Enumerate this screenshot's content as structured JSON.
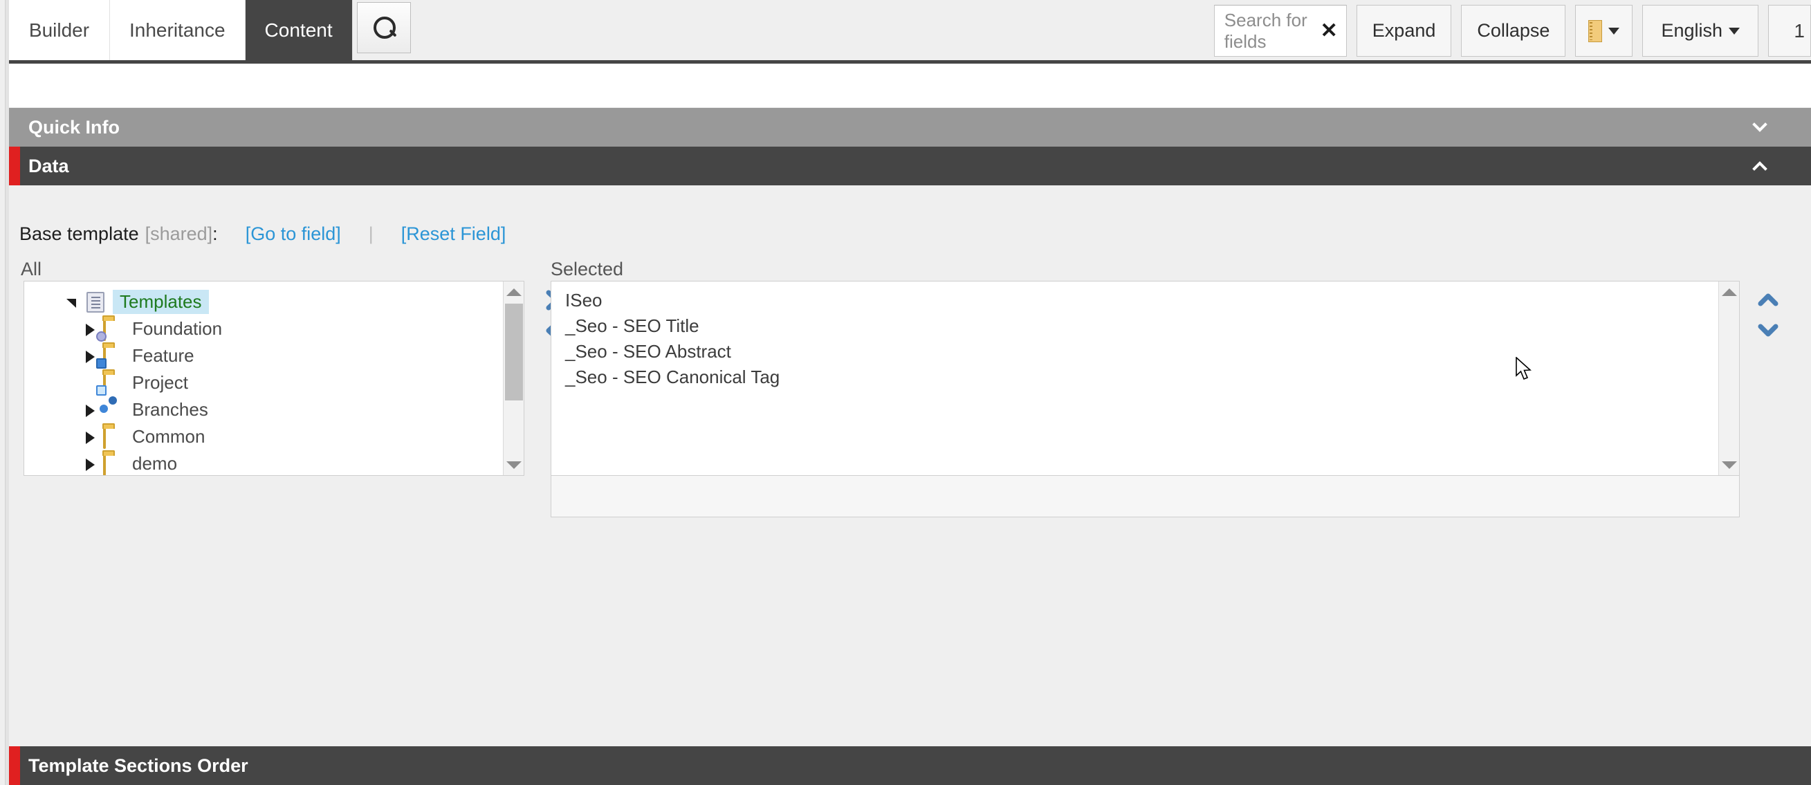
{
  "tabs": [
    {
      "label": "Builder",
      "active": false
    },
    {
      "label": "Inheritance",
      "active": false
    },
    {
      "label": "Content",
      "active": true
    }
  ],
  "search_tab": {
    "icon": "search-icon"
  },
  "toolbar": {
    "search": {
      "placeholder": "Search for fields",
      "value": "",
      "clear": "✕"
    },
    "expand_label": "Expand",
    "collapse_label": "Collapse",
    "ruler_label": "",
    "language_label": "English",
    "version_label": "1",
    "caret": "▾"
  },
  "sections": {
    "quick_info": {
      "title": "Quick Info",
      "chevron": "chevron-down",
      "accent": "#999999"
    },
    "data": {
      "title": "Data",
      "chevron": "chevron-up",
      "accent": "#454545",
      "marker_color": "#e02020"
    },
    "template_sections_order": {
      "title": "Template Sections Order",
      "accent": "#454545",
      "marker_color": "#e02020"
    }
  },
  "field": {
    "label": "Base template",
    "shared": "[shared]",
    "colon": ":",
    "go_to_field": "[Go to field]",
    "separator": "|",
    "reset_field": "[Reset Field]",
    "link_color": "#2b95d6"
  },
  "columns": {
    "all_label": "All",
    "selected_label": "Selected"
  },
  "tree": {
    "items": [
      {
        "label": "Templates",
        "icon": "template-icon",
        "indent": 0,
        "twisty": "open",
        "selected": true
      },
      {
        "label": "Foundation",
        "icon": "folder-gear-icon",
        "indent": 1,
        "twisty": "closed",
        "selected": false
      },
      {
        "label": "Feature",
        "icon": "folder-blocks-icon",
        "indent": 1,
        "twisty": "closed",
        "selected": false
      },
      {
        "label": "Project",
        "icon": "folder-window-icon",
        "indent": 1,
        "twisty": "none",
        "selected": false
      },
      {
        "label": "Branches",
        "icon": "puzzle-icon",
        "indent": 1,
        "twisty": "closed",
        "selected": false
      },
      {
        "label": "Common",
        "icon": "folder-icon",
        "indent": 1,
        "twisty": "closed",
        "selected": false
      },
      {
        "label": "demo",
        "icon": "folder-icon",
        "indent": 1,
        "twisty": "closed",
        "selected": false
      }
    ]
  },
  "selected_list": {
    "items": [
      {
        "label": "ISeo"
      },
      {
        "label": "_Seo - SEO Title"
      },
      {
        "label": "_Seo - SEO Abstract"
      },
      {
        "label": "_Seo - SEO Canonical Tag"
      }
    ]
  },
  "transfer": {
    "add": "chevron-right-icon",
    "remove": "chevron-left-icon"
  },
  "order": {
    "up": "chevron-up-icon",
    "down": "chevron-down-icon"
  }
}
